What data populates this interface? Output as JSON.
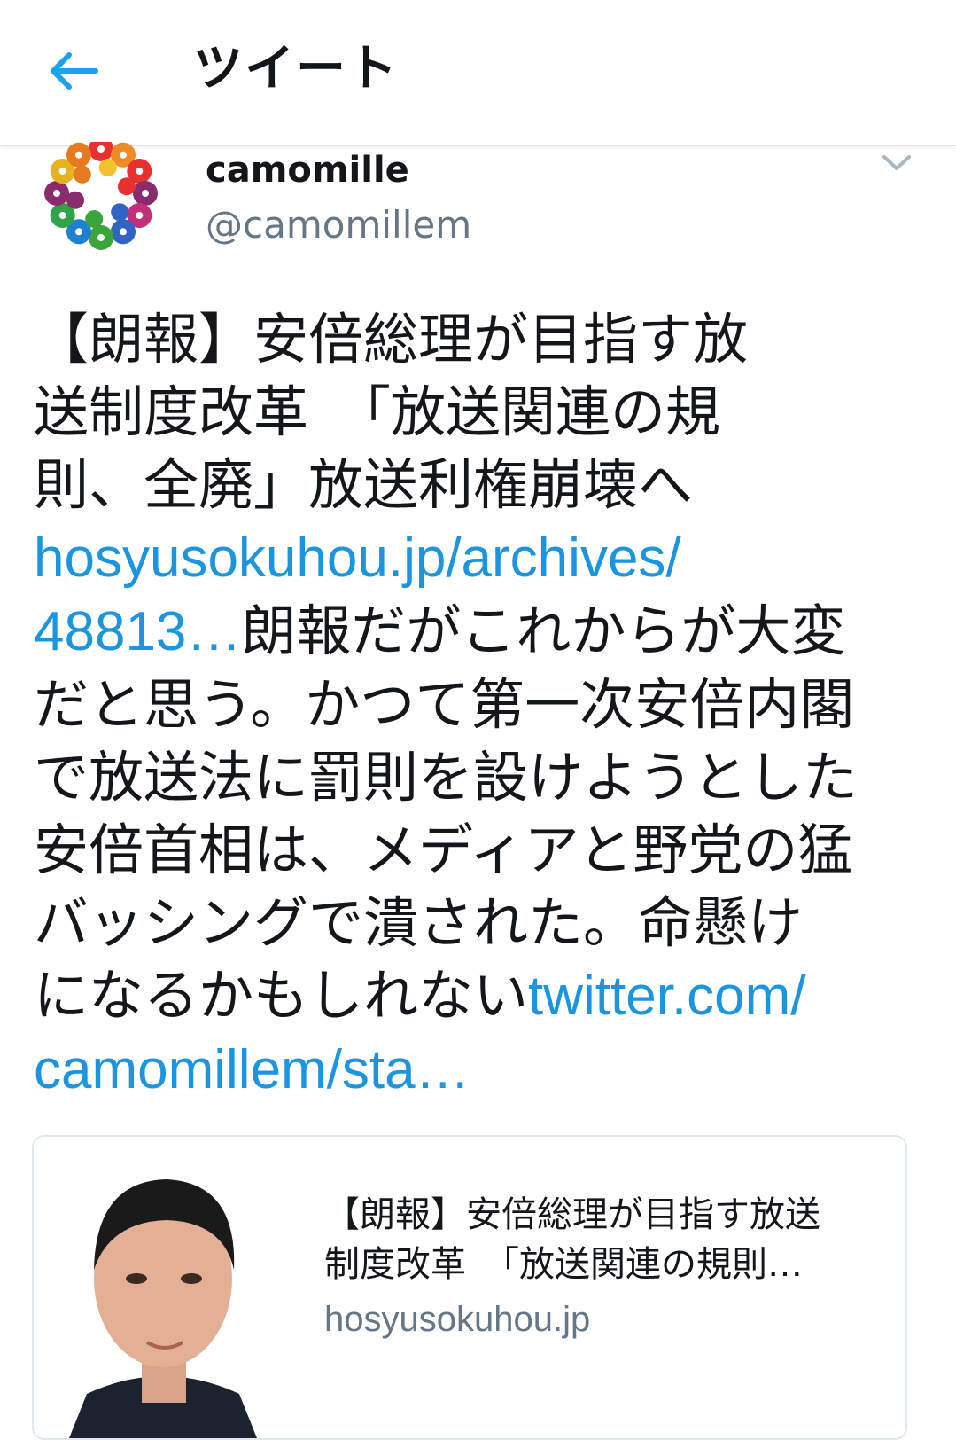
{
  "header": {
    "title": "ツイート",
    "back_icon": "arrow-left-icon",
    "accent_color": "#1da1f2"
  },
  "tweet": {
    "user": {
      "name": "camomille",
      "handle": "@camomillem",
      "avatar_icon": "flower-wreath-avatar"
    },
    "caret_icon": "chevron-down-icon",
    "segments": [
      {
        "text": "【朗報】安倍総理が目指す放\n送制度改革　「放送関連の規\n則、全廃」放送利権崩壊へ\n",
        "link": false
      },
      {
        "text": "hosyusokuhou.jp/archives/\n48813…",
        "link": true
      },
      {
        "text": "朗報だがこれからが大変\nだと思う。かつて第一次安倍内閣\nで放送法に罰則を設けようとした\n安倍首相は、メディアと野党の猛\nバッシングで潰された。命懸け\nになるかもしれない",
        "link": false
      },
      {
        "text": "twitter.com/\ncamomillem/sta…",
        "link": true
      }
    ],
    "link_color": "#1b95e0"
  },
  "card": {
    "title": "【朗報】安倍総理が目指す放送\n制度改革　「放送関連の規則…",
    "domain": "hosyusokuhou.jp",
    "thumbnail": "portrait-photo"
  }
}
